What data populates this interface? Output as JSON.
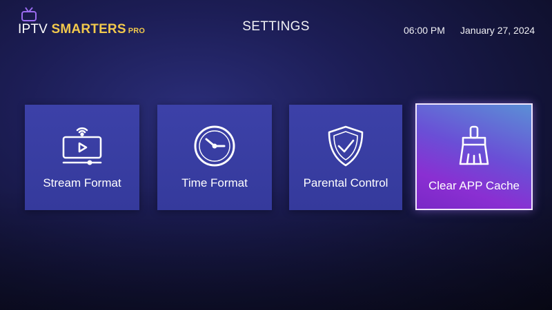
{
  "header": {
    "logo": {
      "iptv": "IPTV",
      "smarters": "SMARTERS",
      "pro": "PRO"
    },
    "title": "SETTINGS",
    "time": "06:00 PM",
    "date": "January 27, 2024"
  },
  "tiles": [
    {
      "label": "Stream Format",
      "icon": "stream-format-icon",
      "focused": false
    },
    {
      "label": "Time Format",
      "icon": "clock-icon",
      "focused": false
    },
    {
      "label": "Parental Control",
      "icon": "shield-check-icon",
      "focused": false
    },
    {
      "label": "Clear APP Cache",
      "icon": "broom-icon",
      "focused": true
    }
  ],
  "colors": {
    "background": "#1c1d55",
    "tile": "#3c41a8",
    "focused_tile": "#8a2fd2",
    "logo_accent": "#f2c94c"
  }
}
